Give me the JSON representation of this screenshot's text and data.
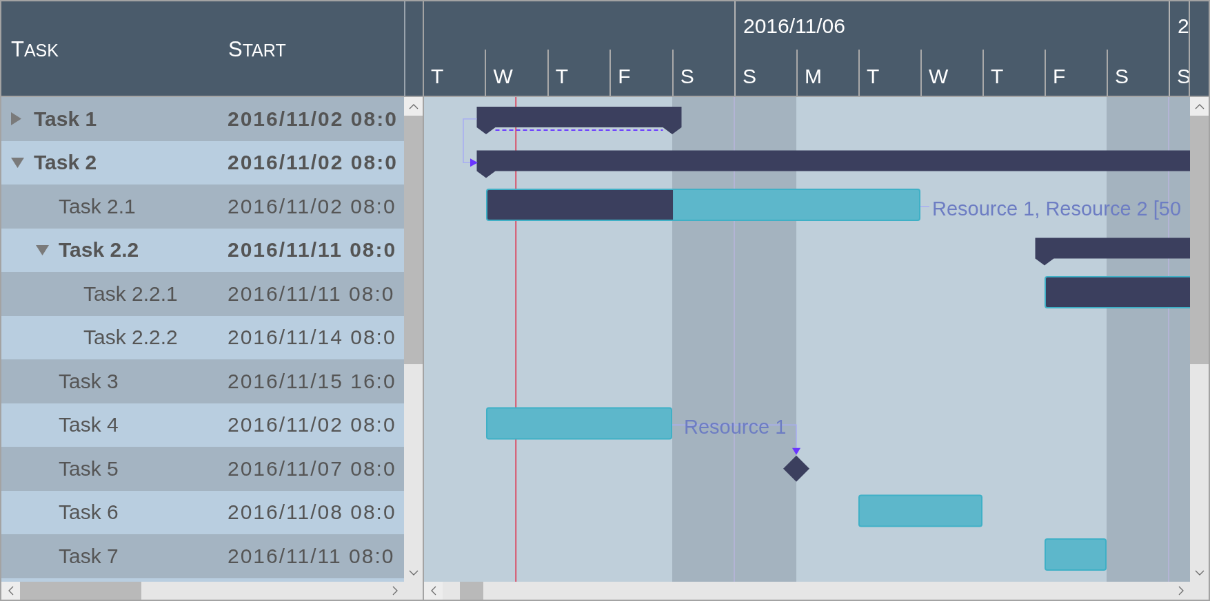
{
  "grid": {
    "columns": [
      {
        "label": "TASK"
      },
      {
        "label": "START"
      }
    ]
  },
  "tasks": [
    {
      "name": "Task 1",
      "start": "2016/11/02 08:0",
      "kind": "summary",
      "expanded": false
    },
    {
      "name": "Task 2",
      "start": "2016/11/02 08:0",
      "kind": "summary",
      "expanded": true,
      "predecessor_links": [
        {
          "kind": "start-to-start"
        }
      ],
      "children": [
        {
          "name": "Task 2.1",
          "start": "2016/11/02 08:0",
          "kind": "task",
          "level": 0.43,
          "resources": "Resource 1, Resource 2 [50",
          "successor_links": [
            {
              "kind": "finish-to-start"
            }
          ]
        },
        {
          "name": "Task 2.2",
          "start": "2016/11/11 08:0",
          "kind": "summary",
          "expanded": true,
          "children": [
            {
              "name": "Task 2.2.1",
              "start": "2016/11/11 08:0",
              "kind": "task",
              "level": 1
            },
            {
              "name": "Task 2.2.2",
              "start": "2016/11/14 08:0",
              "kind": "task"
            }
          ]
        },
        {
          "name": "Task 3",
          "start": "2016/11/15 16:0",
          "kind": "task"
        },
        {
          "name": "Task 4",
          "start": "2016/11/02 08:0",
          "kind": "task",
          "resources": "Resource 1"
        },
        {
          "name": "Task 5",
          "start": "2016/11/07 08:0",
          "kind": "milestone",
          "predecessor_links": [
            {
              "kind": "finish-to-start"
            }
          ]
        },
        {
          "name": "Task 6",
          "start": "2016/11/08 08:0",
          "kind": "task"
        },
        {
          "name": "Task 7",
          "start": "2016/11/11 08:0",
          "kind": "task"
        }
      ]
    }
  ],
  "timescale": {
    "weeks": [
      {
        "days": [
          {
            "label": "T",
            "weekend": false
          },
          {
            "label": "W",
            "weekend": false
          },
          {
            "label": "T",
            "weekend": false
          },
          {
            "label": "F",
            "weekend": false
          },
          {
            "label": "S",
            "weekend": true
          }
        ]
      },
      {
        "label": "2016/11/06",
        "days": [
          {
            "label": "S",
            "weekend": true
          },
          {
            "label": "M",
            "weekend": false
          },
          {
            "label": "T",
            "weekend": false
          },
          {
            "label": "W",
            "weekend": false
          },
          {
            "label": "T",
            "weekend": false
          },
          {
            "label": "F",
            "weekend": false
          },
          {
            "label": "S",
            "weekend": true
          }
        ]
      },
      {
        "label": "2",
        "days": [
          {
            "label": "S",
            "weekend": true
          }
        ]
      }
    ]
  }
}
